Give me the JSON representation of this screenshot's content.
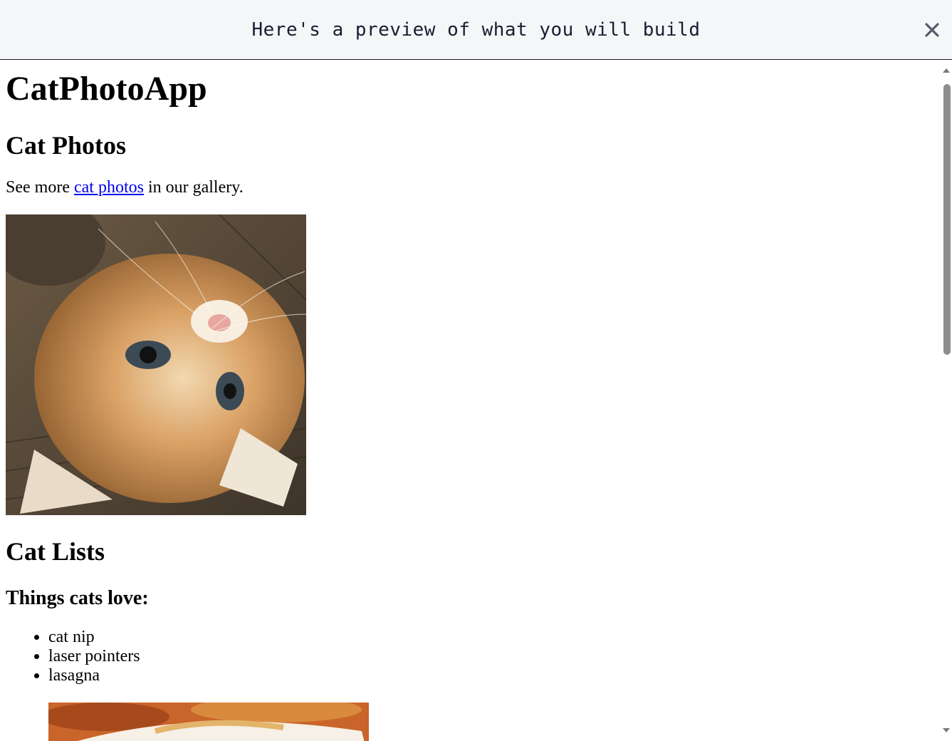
{
  "banner": {
    "text": "Here's a preview of what you will build",
    "close_icon": "close-icon"
  },
  "preview": {
    "title": "CatPhotoApp",
    "section_photos": {
      "heading": "Cat Photos",
      "text_before": "See more ",
      "link_text": "cat photos",
      "text_after": " in our gallery.",
      "image_alt": "A cute orange cat lying on its back."
    },
    "section_lists": {
      "heading": "Cat Lists",
      "subheading": "Things cats love:",
      "items": [
        "cat nip",
        "laser pointers",
        "lasagna"
      ],
      "image_alt": "A slice of lasagna on a plate."
    }
  },
  "colors": {
    "banner_bg": "#f5f6f7",
    "banner_text": "#1b1b32",
    "link": "#0000ee",
    "scroll_thumb": "#8e8e8e"
  }
}
